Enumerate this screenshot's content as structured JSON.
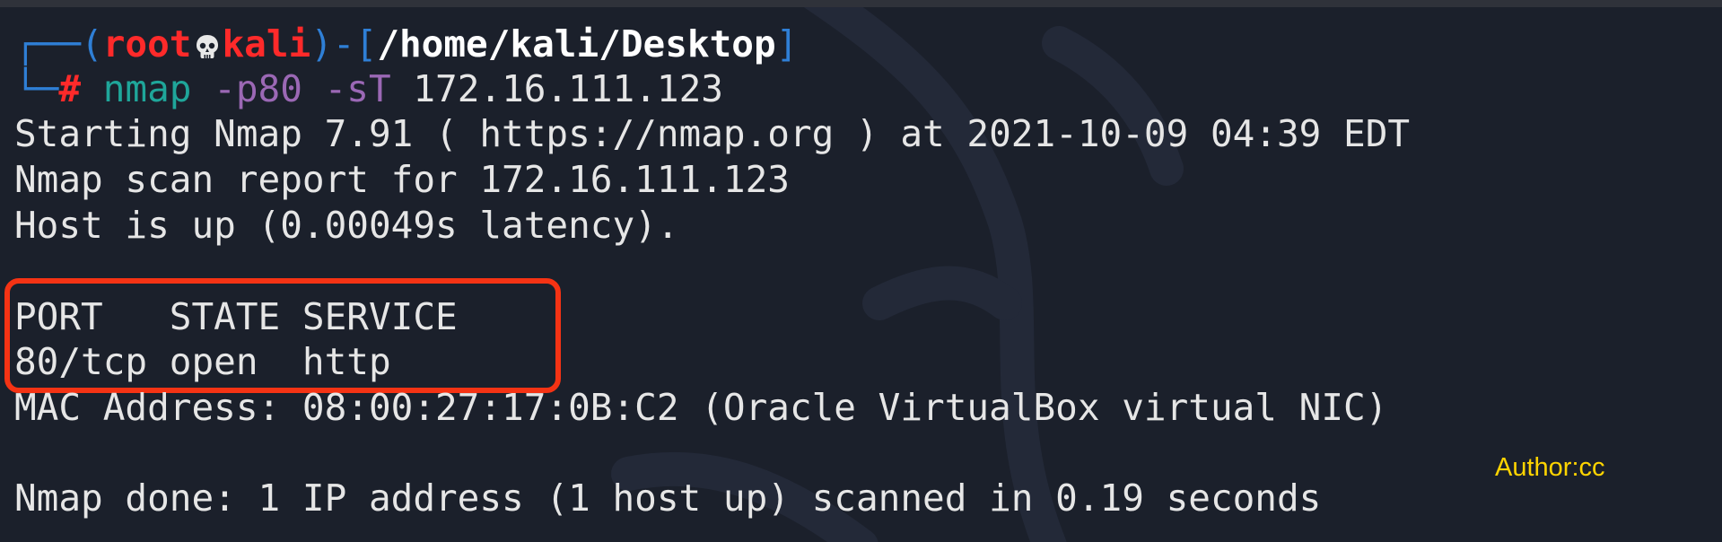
{
  "colors": {
    "background": "#1b202b",
    "prompt_frame": "#2f7fd6",
    "prompt_red": "#ff2a2a",
    "command_teal": "#1fa69a",
    "flags_purple": "#9b68b5",
    "text": "#e6e6e6",
    "highlight_border": "#f53314",
    "author_yellow": "#ffd400"
  },
  "prompt": {
    "frame_open": "┌──(",
    "user": "root",
    "skull_icon": "skull-icon",
    "host": "kali",
    "frame_mid": ")-[",
    "path": "/home/kali/Desktop",
    "frame_close": "]",
    "frame_bottom": "└─",
    "symbol": "#"
  },
  "command": {
    "program": "nmap",
    "flags": "-p80 -sT",
    "target": "172.16.111.123"
  },
  "output": {
    "starting": "Starting Nmap 7.91 ( https://nmap.org ) at 2021-10-09 04:39 EDT",
    "report": "Nmap scan report for 172.16.111.123",
    "host_up": "Host is up (0.00049s latency).",
    "table_header": "PORT   STATE SERVICE",
    "table_row": "80/tcp open  http",
    "mac": "MAC Address: 08:00:27:17:0B:C2 (Oracle VirtualBox virtual NIC)",
    "done": "Nmap done: 1 IP address (1 host up) scanned in 0.19 seconds"
  },
  "author": "Author:cc"
}
